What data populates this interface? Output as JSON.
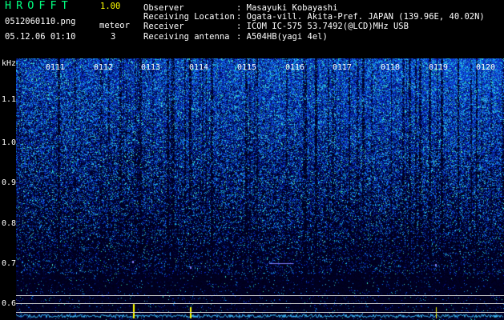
{
  "header": {
    "app_name": "HROFFT",
    "version": "1.00",
    "file_name": "0512060110.png",
    "datetime": "05.12.06 01:10",
    "meteor_label": "meteor",
    "meteor_count": "3"
  },
  "info": [
    {
      "label": "Observer",
      "value": ": Masayuki Kobayashi"
    },
    {
      "label": "Receiving Location",
      "value": ": Ogata-vill. Akita-Pref. JAPAN (139.96E, 40.02N)"
    },
    {
      "label": "Receiver",
      "value": ": ICOM IC-575 53.7492(@LCD)MHz USB"
    },
    {
      "label": "Receiving antenna",
      "value": ": A504HB(yagi 4el)"
    }
  ],
  "plot": {
    "unit": "kHz",
    "y_ticks": [
      "1.1",
      "1.0",
      "0.9",
      "0.8",
      "0.7",
      "0.6"
    ],
    "x_ticks": [
      "0111",
      "0112",
      "0113",
      "0114",
      "0115",
      "0116",
      "0117",
      "0118",
      "0119",
      "0120"
    ]
  },
  "colors": {
    "background": "#000000",
    "text": "#ffffff",
    "title": "#00ff80",
    "version": "#ffff00",
    "noise_low": "#0a1ea0",
    "noise_high": "#3cc8ff",
    "hot": "#50ff80",
    "meteor": "#ffff00",
    "baseline": "#40c0ff"
  },
  "chart_data": {
    "type": "heatmap",
    "title": "",
    "xlabel": "",
    "ylabel": "kHz",
    "x_ticks": [
      "0111",
      "0112",
      "0113",
      "0114",
      "0115",
      "0116",
      "0117",
      "0118",
      "0119",
      "0120"
    ],
    "y_ticks": [
      1.1,
      1.0,
      0.9,
      0.8,
      0.7,
      0.6
    ],
    "ylim": [
      0.57,
      1.19
    ]
  }
}
